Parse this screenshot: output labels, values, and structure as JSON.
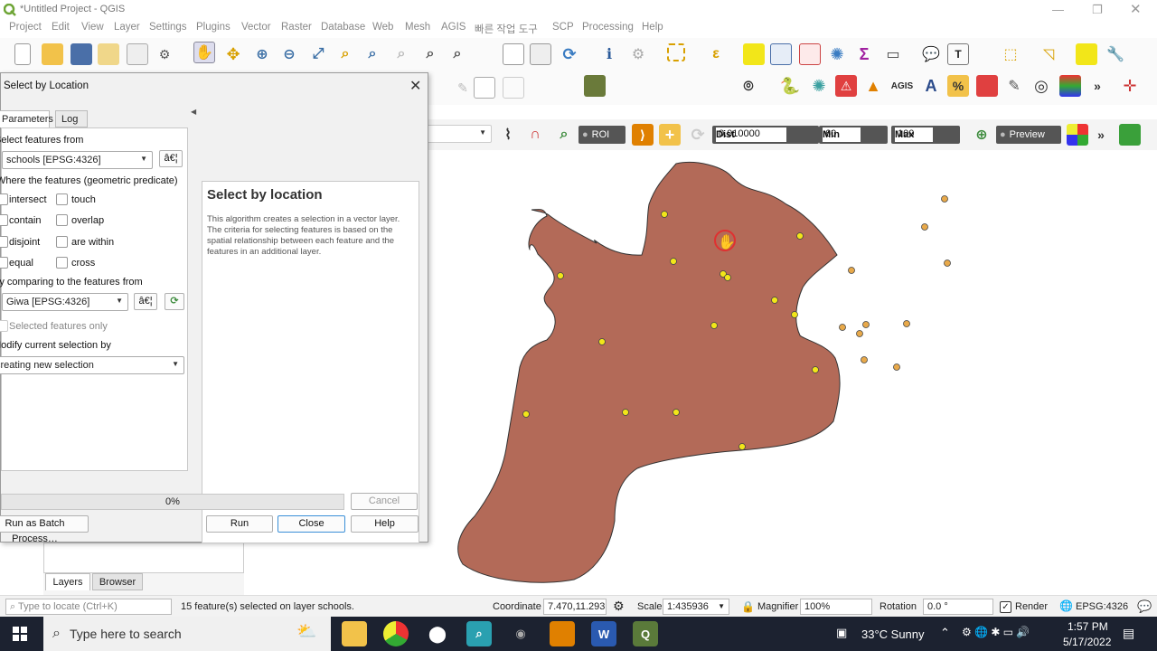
{
  "app": {
    "title": "*Untitled Project - QGIS"
  },
  "menu": [
    "Project",
    "Edit",
    "View",
    "Layer",
    "Settings",
    "Plugins",
    "Vector",
    "Raster",
    "Database",
    "Web",
    "Mesh",
    "AGIS",
    "빠른 작업 도구",
    "SCP",
    "Processing",
    "Help"
  ],
  "scp_toolbar": {
    "roi_label": "ROI",
    "dist_label": "Dist",
    "dist_value": "0.010000",
    "min_label": "Min",
    "min_value": "60",
    "max_label": "Max",
    "max_value": "100",
    "preview_label": "Preview"
  },
  "dialog": {
    "title": "Select by Location",
    "tabs": [
      "Parameters",
      "Log"
    ],
    "select_from_label": "Select features from",
    "select_from_value": "schools [EPSG:4326]",
    "predicate_label": "Where the features (geometric predicate)",
    "predicates": [
      "intersect",
      "touch",
      "contain",
      "overlap",
      "disjoint",
      "are within",
      "equal",
      "cross"
    ],
    "compare_label": "By comparing to the features from",
    "compare_value": "Giwa [EPSG:4326]",
    "selected_only_label": "Selected features only",
    "modify_label": "Modify current selection by",
    "modify_value": "creating new selection",
    "ellipsis": "â€¦",
    "progress": "0%",
    "cancel": "Cancel",
    "batch": "Run as Batch Process…",
    "run": "Run",
    "close": "Close",
    "help_button": "Help",
    "help_title": "Select by location",
    "help_text": "This algorithm creates a selection in a vector layer. The criteria for selecting features is based on the spatial relationship between each feature and the features in an additional layer."
  },
  "panel_tabs": [
    "Layers",
    "Browser"
  ],
  "status": {
    "locate_placeholder": "Type to locate (Ctrl+K)",
    "message": "15 feature(s) selected on layer schools.",
    "coordinate_label": "Coordinate",
    "coordinate_value": "7.470,11.293",
    "scale_label": "Scale",
    "scale_value": "1:435936",
    "magnifier_label": "Magnifier",
    "magnifier_value": "100%",
    "rotation_label": "Rotation",
    "rotation_value": "0.0 °",
    "render_label": "Render",
    "crs": "EPSG:4326"
  },
  "taskbar": {
    "search_placeholder": "Type here to search",
    "weather": "33°C  Sunny",
    "time": "1:57 PM",
    "date": "5/17/2022"
  },
  "colors": {
    "polygon": "#b36a58",
    "selected_point": "#f2e619",
    "point": "#e8a94a"
  }
}
